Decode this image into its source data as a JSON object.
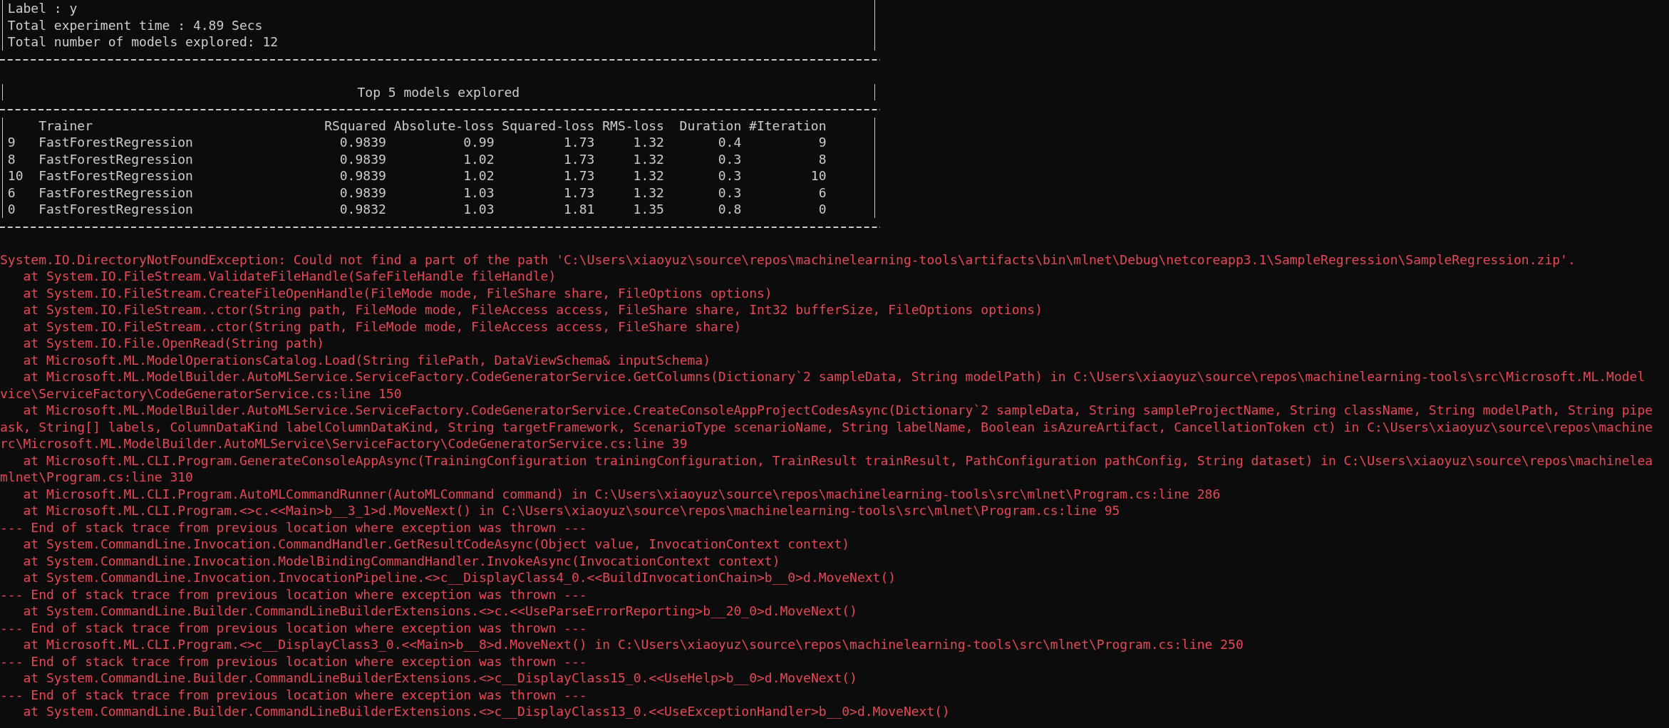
{
  "summary_lines": [
    "Label : y",
    "Total experiment time : 4.89 Secs",
    "Total number of models explored: 12"
  ],
  "models_table": {
    "title": "Top 5 models explored",
    "columns": [
      "Trainer",
      "RSquared",
      "Absolute-loss",
      "Squared-loss",
      "RMS-loss",
      "Duration",
      "#Iteration"
    ],
    "rows": [
      {
        "index": "9",
        "cells": [
          "FastForestRegression",
          "0.9839",
          "0.99",
          "1.73",
          "1.32",
          "0.4",
          "9"
        ]
      },
      {
        "index": "8",
        "cells": [
          "FastForestRegression",
          "0.9839",
          "1.02",
          "1.73",
          "1.32",
          "0.3",
          "8"
        ]
      },
      {
        "index": "10",
        "cells": [
          "FastForestRegression",
          "0.9839",
          "1.02",
          "1.73",
          "1.32",
          "0.3",
          "10"
        ]
      },
      {
        "index": "6",
        "cells": [
          "FastForestRegression",
          "0.9839",
          "1.03",
          "1.73",
          "1.32",
          "0.3",
          "6"
        ]
      },
      {
        "index": "0",
        "cells": [
          "FastForestRegression",
          "0.9832",
          "1.03",
          "1.81",
          "1.35",
          "0.8",
          "0"
        ]
      }
    ]
  },
  "error_output": {
    "lines": [
      "System.IO.DirectoryNotFoundException: Could not find a part of the path 'C:\\Users\\xiaoyuz\\source\\repos\\machinelearning-tools\\artifacts\\bin\\mlnet\\Debug\\netcoreapp3.1\\SampleRegression\\SampleRegression.zip'.",
      "   at System.IO.FileStream.ValidateFileHandle(SafeFileHandle fileHandle)",
      "   at System.IO.FileStream.CreateFileOpenHandle(FileMode mode, FileShare share, FileOptions options)",
      "   at System.IO.FileStream..ctor(String path, FileMode mode, FileAccess access, FileShare share, Int32 bufferSize, FileOptions options)",
      "   at System.IO.FileStream..ctor(String path, FileMode mode, FileAccess access, FileShare share)",
      "   at System.IO.File.OpenRead(String path)",
      "   at Microsoft.ML.ModelOperationsCatalog.Load(String filePath, DataViewSchema& inputSchema)",
      "   at Microsoft.ML.ModelBuilder.AutoMLService.ServiceFactory.CodeGeneratorService.GetColumns(Dictionary`2 sampleData, String modelPath) in C:\\Users\\xiaoyuz\\source\\repos\\machinelearning-tools\\src\\Microsoft.ML.Model",
      "vice\\ServiceFactory\\CodeGeneratorService.cs:line 150",
      "   at Microsoft.ML.ModelBuilder.AutoMLService.ServiceFactory.CodeGeneratorService.CreateConsoleAppProjectCodesAsync(Dictionary`2 sampleData, String sampleProjectName, String className, String modelPath, String pipe",
      "ask, String[] labels, ColumnDataKind labelColumnDataKind, String targetFramework, ScenarioType scenarioName, String labelName, Boolean isAzureArtifact, CancellationToken ct) in C:\\Users\\xiaoyuz\\source\\repos\\machine",
      "rc\\Microsoft.ML.ModelBuilder.AutoMLService\\ServiceFactory\\CodeGeneratorService.cs:line 39",
      "   at Microsoft.ML.CLI.Program.GenerateConsoleAppAsync(TrainingConfiguration trainingConfiguration, TrainResult trainResult, PathConfiguration pathConfig, String dataset) in C:\\Users\\xiaoyuz\\source\\repos\\machinelea",
      "mlnet\\Program.cs:line 310",
      "   at Microsoft.ML.CLI.Program.AutoMLCommandRunner(AutoMLCommand command) in C:\\Users\\xiaoyuz\\source\\repos\\machinelearning-tools\\src\\mlnet\\Program.cs:line 286",
      "   at Microsoft.ML.CLI.Program.<>c.<<Main>b__3_1>d.MoveNext() in C:\\Users\\xiaoyuz\\source\\repos\\machinelearning-tools\\src\\mlnet\\Program.cs:line 95",
      "--- End of stack trace from previous location where exception was thrown ---",
      "   at System.CommandLine.Invocation.CommandHandler.GetResultCodeAsync(Object value, InvocationContext context)",
      "   at System.CommandLine.Invocation.ModelBindingCommandHandler.InvokeAsync(InvocationContext context)",
      "   at System.CommandLine.Invocation.InvocationPipeline.<>c__DisplayClass4_0.<<BuildInvocationChain>b__0>d.MoveNext()",
      "--- End of stack trace from previous location where exception was thrown ---",
      "   at System.CommandLine.Builder.CommandLineBuilderExtensions.<>c.<<UseParseErrorReporting>b__20_0>d.MoveNext()",
      "--- End of stack trace from previous location where exception was thrown ---",
      "   at Microsoft.ML.CLI.Program.<>c__DisplayClass3_0.<<Main>b__8>d.MoveNext() in C:\\Users\\xiaoyuz\\source\\repos\\machinelearning-tools\\src\\mlnet\\Program.cs:line 250",
      "--- End of stack trace from previous location where exception was thrown ---",
      "   at System.CommandLine.Builder.CommandLineBuilderExtensions.<>c__DisplayClass15_0.<<UseHelp>b__0>d.MoveNext()",
      "--- End of stack trace from previous location where exception was thrown ---",
      "   at System.CommandLine.Builder.CommandLineBuilderExtensions.<>c__DisplayClass13_0.<<UseExceptionHandler>b__0>d.MoveNext()"
    ]
  }
}
